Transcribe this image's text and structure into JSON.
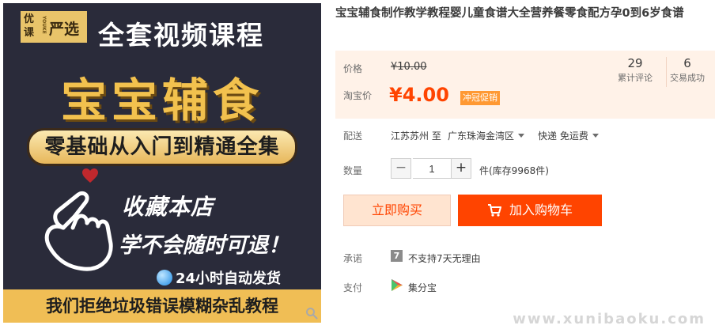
{
  "image": {
    "brand_youke": "优课",
    "brand_youke_en": "YOUKE",
    "brand_yanxuan": "严选",
    "headline": "全套视频课程",
    "main_title": "宝宝辅食",
    "sub_banner": "零基础从入门到精通全集",
    "store_favorite": "收藏本店",
    "refund_text": "学不会随时可退！",
    "auto_ship": "24小时自动发货",
    "bottom_banner": "我们拒绝垃圾错误模糊杂乱教程"
  },
  "product": {
    "title": "宝宝辅食制作教学教程婴儿童食谱大全营养餐零食配方孕0到6岁食谱"
  },
  "price": {
    "price_label": "价格",
    "original_price": "¥10.00",
    "tb_price_label": "淘宝价",
    "tb_price": "¥4.00",
    "promo_tag": "冲冠促销"
  },
  "stats": {
    "reviews_count": "29",
    "reviews_label": "累计评论",
    "sales_count": "6",
    "sales_label": "交易成功"
  },
  "delivery": {
    "label": "配送",
    "from": "江苏苏州 至",
    "to": "广东珠海金湾区",
    "method": "快递 免运费"
  },
  "quantity": {
    "label": "数量",
    "value": "1",
    "minus": "−",
    "plus": "+",
    "stock": "件(库存9968件)"
  },
  "actions": {
    "buy_now": "立即购买",
    "add_to_cart": "加入购物车"
  },
  "promise": {
    "label": "承诺",
    "icon_text": "7",
    "text": "不支持7天无理由"
  },
  "payment": {
    "label": "支付",
    "text": "集分宝"
  },
  "watermark": "www.xunibaoku.com",
  "colors": {
    "accent": "#ff4400",
    "price_panel_bg": "#fff2e8",
    "promo_tag": "#ff9933",
    "image_bg": "#2a2b3a",
    "image_gold": "#f2c14e"
  }
}
